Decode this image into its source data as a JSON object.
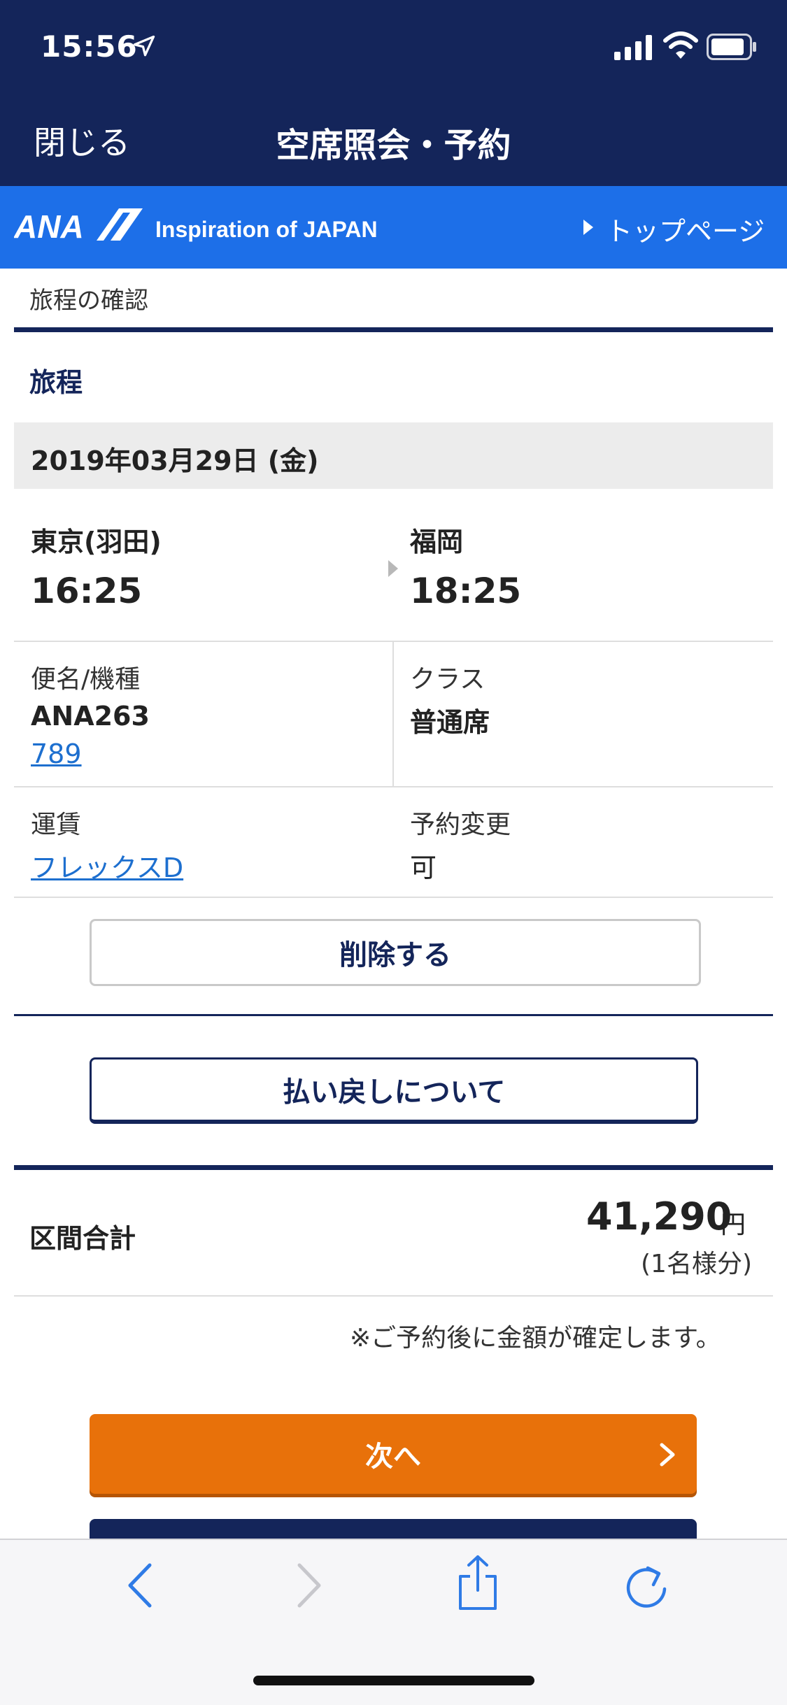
{
  "status_bar": {
    "time": "15:56"
  },
  "nav": {
    "close_label": "閉じる",
    "title": "空席照会・予約"
  },
  "brand": {
    "logo_text": "ANA",
    "tagline": "Inspiration of JAPAN",
    "top_page_link": "トップページ"
  },
  "breadcrumb": "旅程の確認",
  "itinerary": {
    "section_title": "旅程",
    "date": "2019年03月29日 (金)",
    "departure": {
      "city": "東京(羽田)",
      "time": "16:25"
    },
    "arrival": {
      "city": "福岡",
      "time": "18:25"
    },
    "flight_label": "便名/機種",
    "flight_number": "ANA263",
    "aircraft": "789",
    "class_label": "クラス",
    "class_value": "普通席",
    "fare_label": "運賃",
    "fare_value": "フレックスD",
    "change_label": "予約変更",
    "change_value": "可",
    "delete_button": "削除する"
  },
  "refund_button": "払い戻しについて",
  "total": {
    "label": "区間合計",
    "amount": "41,290",
    "unit": "円",
    "note": "(1名様分)",
    "confirm_note": "※ご予約後に金額が確定します。"
  },
  "next_button": "次へ",
  "colors": {
    "navy": "#14255a",
    "brand_blue": "#1d6fe8",
    "orange": "#e8710a",
    "link": "#1d6fcf"
  },
  "toolbar": {
    "icons": [
      "back-icon",
      "forward-icon",
      "share-icon",
      "reload-icon"
    ]
  }
}
